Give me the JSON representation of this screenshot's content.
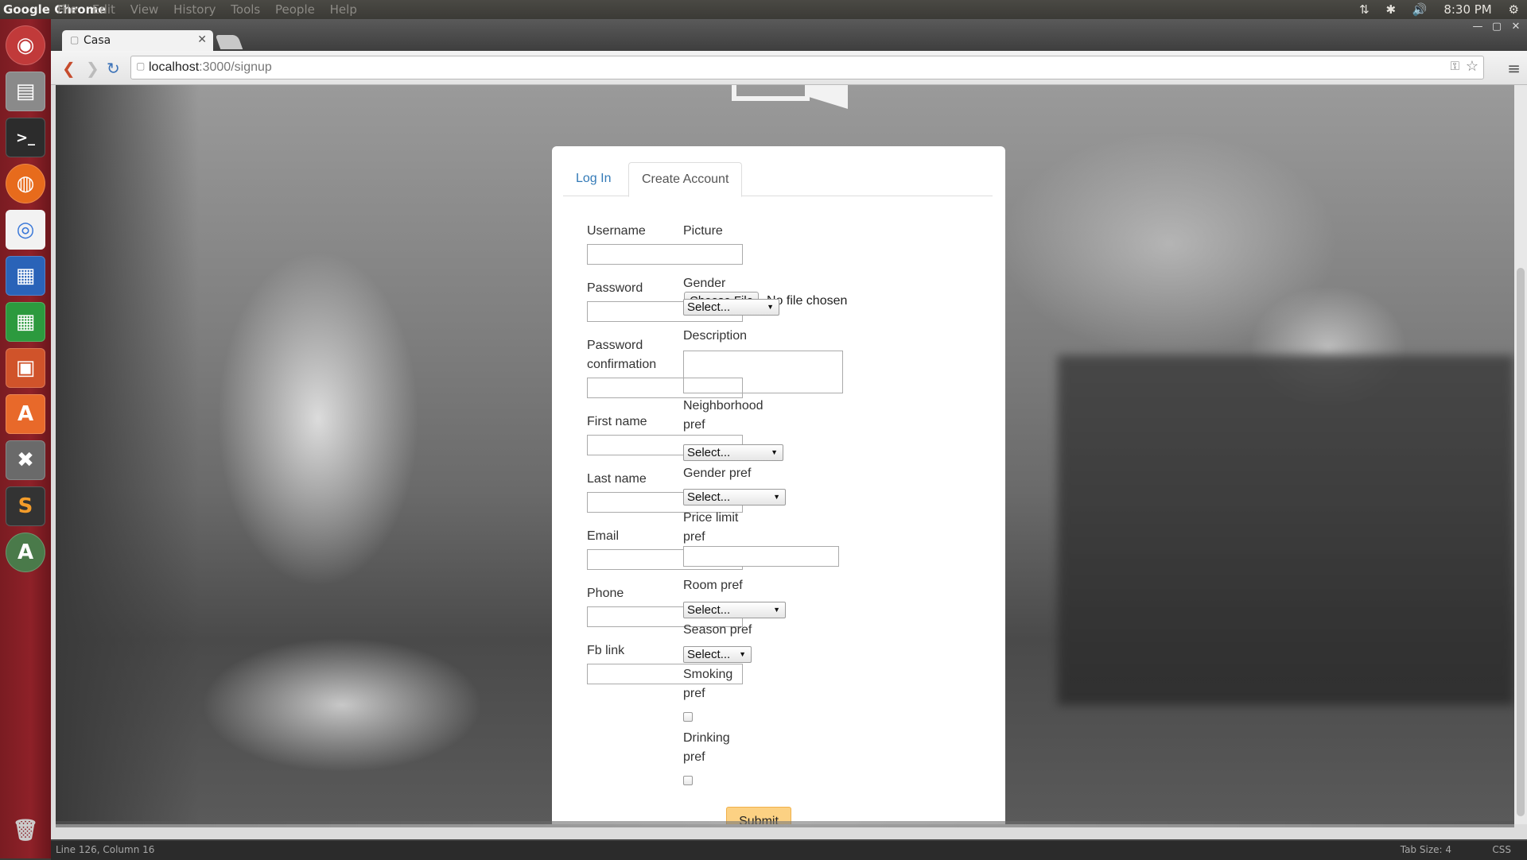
{
  "topbar": {
    "app_name": "Google Chrome",
    "menus": [
      "File",
      "Edit",
      "View",
      "History",
      "Tools",
      "People",
      "Help"
    ],
    "time": "8:30 PM"
  },
  "browser": {
    "tab_title": "Casa",
    "url_host": "localhost",
    "url_rest": ":3000/signup"
  },
  "tabs": {
    "login": "Log In",
    "create": "Create Account"
  },
  "form": {
    "username": "Username",
    "password": "Password",
    "password_confirmation_1": "Password",
    "password_confirmation_2": "confirmation",
    "first_name": "First name",
    "last_name": "Last name",
    "email": "Email",
    "phone": "Phone",
    "fb_link": "Fb link",
    "picture": "Picture",
    "choose_file": "Choose File",
    "no_file": "No file chosen",
    "gender": "Gender",
    "description": "Description",
    "neighborhood_1": "Neighborhood",
    "neighborhood_2": "pref",
    "gender_pref": "Gender pref",
    "price_1": "Price limit",
    "price_2": "pref",
    "room_pref": "Room pref",
    "season_pref": "Season pref",
    "smoking_1": "Smoking",
    "smoking_2": "pref",
    "drinking_1": "Drinking",
    "drinking_2": "pref",
    "select_placeholder": "Select...",
    "submit": "Submit"
  },
  "statusbar": {
    "position": "Line 126, Column 16",
    "tab_size": "Tab Size: 4",
    "syntax": "CSS"
  },
  "colors": {
    "launcher": "#8e2128",
    "link": "#337ab7",
    "submit_bg": "#fcd183"
  }
}
